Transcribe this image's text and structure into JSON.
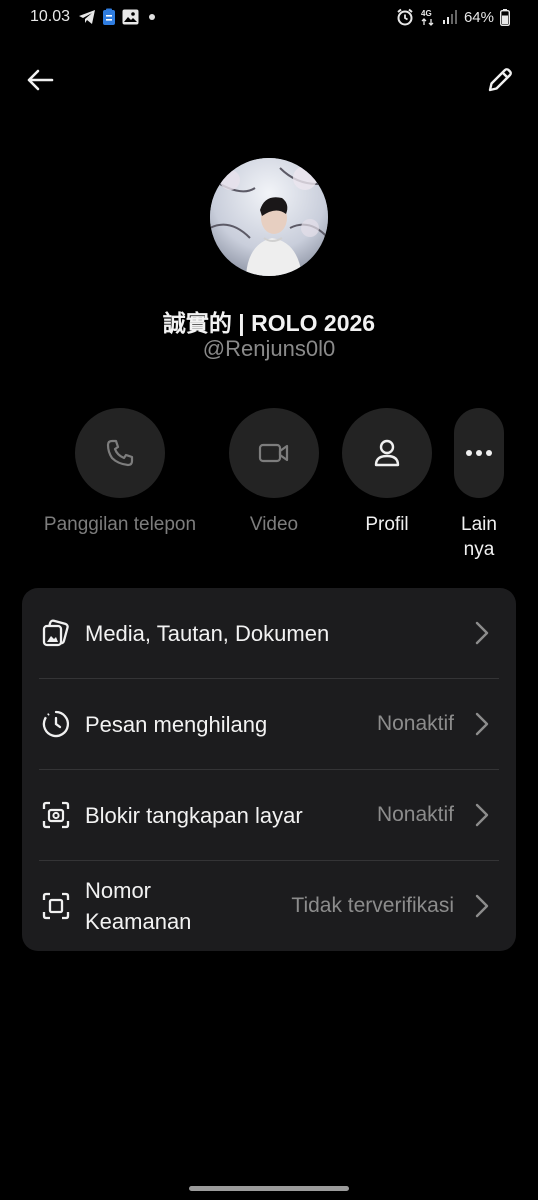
{
  "status_bar": {
    "time": "10.03",
    "battery": "64%",
    "network": "4G"
  },
  "header": {
    "back_icon": "arrow-left-icon",
    "edit_icon": "pencil-icon"
  },
  "profile": {
    "name": "誠實的 | ROLO 2026",
    "handle": "@Renjuns0l0"
  },
  "actions": [
    {
      "label": "Panggilan telepon",
      "icon": "phone-icon",
      "enabled": false
    },
    {
      "label": "Video",
      "icon": "video-icon",
      "enabled": false
    },
    {
      "label": "Profil",
      "icon": "person-icon",
      "enabled": true
    },
    {
      "label": "Lain\nnya",
      "icon": "more-horizontal-icon",
      "enabled": true
    }
  ],
  "settings": [
    {
      "title": "Media, Tautan, Dokumen",
      "value": "",
      "icon": "media-icon"
    },
    {
      "title": "Pesan menghilang",
      "value": "Nonaktif",
      "icon": "timer-icon"
    },
    {
      "title": "Blokir tangkapan layar",
      "value": "Nonaktif",
      "icon": "screenshot-block-icon"
    },
    {
      "title": "Nomor\nKeamanan",
      "value": "Tidak terverifikasi",
      "icon": "security-number-icon"
    }
  ],
  "colors": {
    "background": "#000000",
    "card": "#1c1c1e",
    "button": "#232323",
    "muted_text": "#8c8c8c"
  }
}
